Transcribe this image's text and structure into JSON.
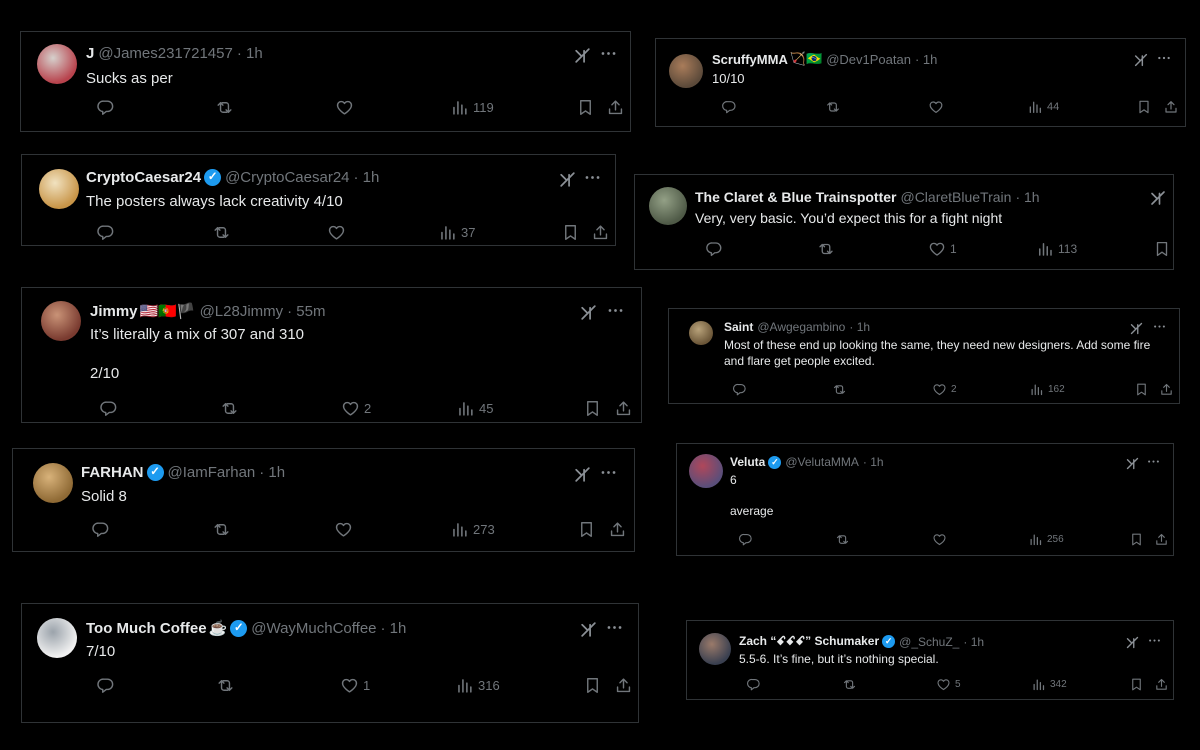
{
  "tweets": [
    {
      "name": "J",
      "handle": "@James231721457",
      "time": "· 1h",
      "text": "Sucks as per",
      "replies": "",
      "retweets": "",
      "likes": "",
      "views": "119",
      "verified": false,
      "emoji": "",
      "avatar": [
        "#b8434d",
        "#d6d0cc"
      ]
    },
    {
      "name": "CryptoCaesar24",
      "handle": "@CryptoCaesar24",
      "time": "· 1h",
      "text": "The posters always lack creativity 4/10",
      "replies": "",
      "retweets": "",
      "likes": "",
      "views": "37",
      "verified": true,
      "emoji": "",
      "avatar": [
        "#c89548",
        "#f1e2c0"
      ]
    },
    {
      "name": "Jimmy",
      "handle": "@L28Jimmy",
      "time": "· 55m",
      "text": "It’s literally a mix of 307 and 310\n\n2/10",
      "replies": "",
      "retweets": "",
      "likes": "2",
      "views": "45",
      "verified": false,
      "emoji": "🇺🇸🇵🇹🏴",
      "avatar": [
        "#7a3b30",
        "#c99377"
      ]
    },
    {
      "name": "FARHAN",
      "handle": "@IamFarhan",
      "time": "· 1h",
      "text": "Solid 8",
      "replies": "",
      "retweets": "",
      "likes": "",
      "views": "273",
      "verified": true,
      "emoji": "",
      "avatar": [
        "#8f6a35",
        "#d8b27a"
      ]
    },
    {
      "name": "Too Much Coffee",
      "handle": "@WayMuchCoffee",
      "time": "· 1h",
      "text": "7/10",
      "replies": "",
      "retweets": "",
      "likes": "1",
      "views": "316",
      "verified": true,
      "emoji": "☕",
      "avatar": [
        "#f1f1f1",
        "#9ba3ab"
      ]
    },
    {
      "name": "ScruffyMMA",
      "handle": "@Dev1Poatan",
      "time": "· 1h",
      "text": "10/10",
      "replies": "",
      "retweets": "",
      "likes": "",
      "views": "44",
      "verified": false,
      "emoji": "🏹🇧🇷",
      "avatar": [
        "#5c4a3a",
        "#a97c5a"
      ]
    },
    {
      "name": "The Claret & Blue Trainspotter",
      "handle": "@ClaretBlueTrain",
      "time": "· 1h",
      "text": "Very, very basic. You’d expect this for a fight night",
      "replies": "",
      "retweets": "",
      "likes": "1",
      "views": "113",
      "verified": false,
      "emoji": "",
      "avatar": [
        "#4f5a47",
        "#93a086"
      ]
    },
    {
      "name": "Saint",
      "handle": "@Awgegambino",
      "time": "· 1h",
      "text": "Most of these end up looking the same, they need new designers. Add some fire and flare get people excited.",
      "replies": "",
      "retweets": "",
      "likes": "2",
      "views": "162",
      "verified": false,
      "emoji": "",
      "avatar": [
        "#6b5638",
        "#b8a27a"
      ]
    },
    {
      "name": "Veluta",
      "handle": "@VelutaMMA",
      "time": "· 1h",
      "text": "6\n\naverage",
      "replies": "",
      "retweets": "",
      "likes": "",
      "views": "256",
      "verified": true,
      "emoji": "",
      "avatar": [
        "#5a4e7a",
        "#b0475a"
      ]
    },
    {
      "name": "Zach “ꗃꗃꗃ” Schumaker",
      "handle": "@_SchuZ_",
      "time": "· 1h",
      "text": "5.5-6. It’s fine, but it’s nothing special.",
      "replies": "",
      "retweets": "",
      "likes": "5",
      "views": "342",
      "verified": true,
      "emoji": "",
      "avatar": [
        "#3a4050",
        "#9a7a6a"
      ]
    }
  ],
  "icons": {
    "reply": "reply-icon",
    "retweet": "retweet-icon",
    "like": "heart-icon",
    "views": "views-icon",
    "bookmark": "bookmark-icon",
    "share": "share-icon",
    "grok": "grok-icon",
    "more": "more-icon"
  },
  "colors": {
    "background": "#000000",
    "text": "#e7e9ea",
    "muted": "#71767b",
    "border": "#2f3336",
    "verified": "#1d9bf0"
  }
}
